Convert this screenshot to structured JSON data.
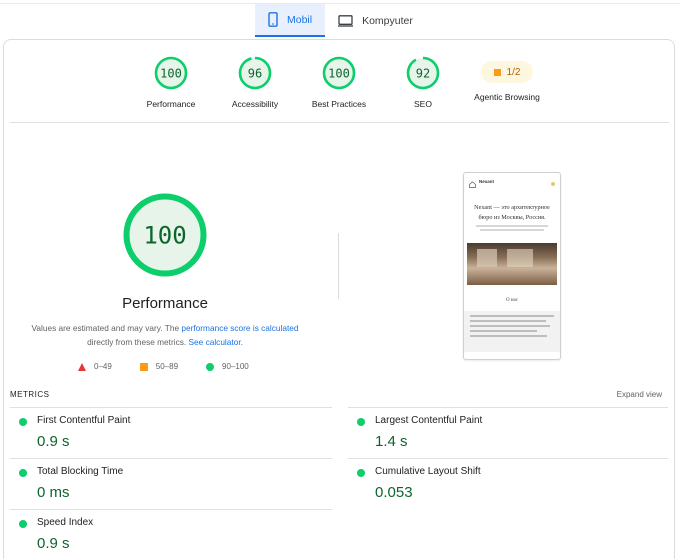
{
  "tabs": [
    {
      "label": "Mobil",
      "icon": "smartphone-icon",
      "active": true
    },
    {
      "label": "Kompyuter",
      "icon": "desktop-icon",
      "active": false
    }
  ],
  "categories": [
    {
      "label": "Performance",
      "score": "100",
      "level": 1.0
    },
    {
      "label": "Accessibility",
      "score": "96",
      "level": 0.96
    },
    {
      "label": "Best Practices",
      "score": "100",
      "level": 1.0
    },
    {
      "label": "SEO",
      "score": "92",
      "level": 0.92
    },
    {
      "label": "Agentic Browsing",
      "score": "1/2"
    }
  ],
  "main": {
    "score": "100",
    "level": 1.0,
    "title": "Performance",
    "note_prefix": "Values are estimated and may vary. The ",
    "note_link1": "performance score is calculated",
    "note_middle": " directly from these metrics. ",
    "note_link2": "See calculator."
  },
  "legend": [
    {
      "range": "0–49",
      "shape": "triangle",
      "color": "#e53935"
    },
    {
      "range": "50–89",
      "shape": "square",
      "color": "#fa9c1a"
    },
    {
      "range": "90–100",
      "shape": "circle",
      "color": "#0cce6b"
    }
  ],
  "preview": {
    "brand": "Nexant",
    "headline": "Nexant — это архитектурное бюро из Москвы, Россия.",
    "section": "О нас"
  },
  "metrics_section": {
    "title": "METRICS",
    "expand": "Expand view"
  },
  "metrics": [
    {
      "name": "First Contentful Paint",
      "value": "0.9 s"
    },
    {
      "name": "Largest Contentful Paint",
      "value": "1.4 s"
    },
    {
      "name": "Total Blocking Time",
      "value": "0 ms"
    },
    {
      "name": "Cumulative Layout Shift",
      "value": "0.053"
    },
    {
      "name": "Speed Index",
      "value": "0.9 s"
    }
  ],
  "colors": {
    "pass": "#0cce6b",
    "pass_text": "#0d652d",
    "pass_fill": "#e6f4ea",
    "accent": "#1a73e8",
    "average": "#fa9c1a",
    "fail": "#e53935"
  }
}
